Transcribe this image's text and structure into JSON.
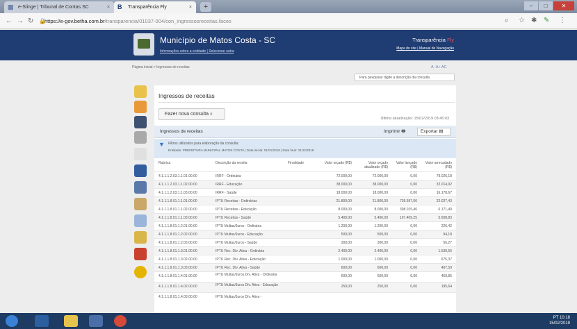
{
  "browser": {
    "tabs": [
      {
        "label": "e-Slinge | Tribunal de Contas SC"
      },
      {
        "label": "Transparência Fly"
      }
    ],
    "new_tab": "+",
    "url_host": "https://e-gov.betha.com.br",
    "url_path": "/transparencia/01037-004/con_ingressosreceitas.faces"
  },
  "header": {
    "municipality": "Município de Matos Costa - SC",
    "links": "Informações sobre a entidade | Selecionar outra",
    "brand": "Transparência",
    "brand_accent": "Fly",
    "brand_links": "Mapa do site | Manual de Navegação"
  },
  "breadcrumb": "Página inicial  >  Ingressos de receitas",
  "zoom": "A-  A+  AC",
  "search_placeholder": "Para pesquisar digite a descrição da consulta",
  "content": {
    "title": "Ingressos de receitas",
    "new_query": "Fazer nova consulta",
    "last_update": "Última atualização: 15/02/2019 03:45:03",
    "table_title": "Ingressos de receitas",
    "print": "Imprimir",
    "export": "Exportar",
    "filter_line1": "Filtros utilizados para elaboração da consulta:",
    "filter_line2": "Entidade: PREFEITURA MUNICIPAL MATOS COSTA | Data inicial: 01/01/2018 | Data final: 31/12/2018",
    "columns": [
      "Rubrica",
      "Descrição da receita",
      "Finalidade",
      "Valor orçado (R$)",
      "Valor orçado atualizado (R$)",
      "Valor lançado (R$)",
      "Valor arrecadado (R$)"
    ],
    "rows": [
      [
        "4.1.1.1.2.03.1.1.01.00.00",
        "IRRF - Ordinária",
        "",
        "72.000,00",
        "72.000,00",
        "0,00",
        "79.026,18"
      ],
      [
        "4.1.1.1.2.03.1.1.02.00.00",
        "IRRF - Educação",
        "",
        "38.000,00",
        "38.000,00",
        "0,00",
        "32.014,92"
      ],
      [
        "4.1.1.1.2.03.1.1.03.00.00",
        "IRRF - Saúde",
        "",
        "18.000,00",
        "18.000,00",
        "0,00",
        "16.178,67"
      ],
      [
        "4.1.1.1.8.01.1.1.01.00.00",
        "IPTU Receitas - Ordinárias",
        "",
        "21.800,00",
        "21.800,00",
        "739.697,00",
        "22.027,43"
      ],
      [
        "4.1.1.1.8.01.1.1.02.00.00",
        "IPTU Receitas - Educação",
        "",
        "8.000,00",
        "8.000,00",
        "308.015,46",
        "6.171,49"
      ],
      [
        "4.1.1.1.8.01.1.1.03.00.00",
        "IPTU Receitas - Saúde",
        "",
        "5.400,00",
        "5.400,00",
        "197.409,25",
        "5.608,83"
      ],
      [
        "4.1.1.1.8.01.1.2.01.00.00",
        "IPTU Multas/Juros - Ordinária",
        "",
        "1.200,00",
        "1.200,00",
        "0,00",
        "226,42"
      ],
      [
        "4.1.1.1.8.01.1.2.02.00.00",
        "IPTU Multas/Juros - Educação",
        "",
        "500,00",
        "500,00",
        "0,00",
        "94,18"
      ],
      [
        "4.1.1.1.8.01.1.2.03.00.00",
        "IPTU Multas/Juros - Saúde",
        "",
        "300,00",
        "300,00",
        "0,00",
        "56,27"
      ],
      [
        "4.1.1.1.8.01.1.3.01.00.00",
        "IPTU Rec. Dív. Ativa - Ordinária",
        "",
        "2.400,00",
        "2.400,00",
        "0,00",
        "1.630,55"
      ],
      [
        "4.1.1.1.8.01.1.3.02.00.00",
        "IPTU Rec. Dív. Ativa - Educação",
        "",
        "1.000,00",
        "1.000,00",
        "0,00",
        "675,37"
      ],
      [
        "4.1.1.1.8.01.1.3.03.00.00",
        "IPTU Rec. Dív. Ativa - Saúde",
        "",
        "600,00",
        "600,00",
        "0,00",
        "407,59"
      ],
      [
        "4.1.1.1.8.01.1.4.01.00.00",
        "IPTU Multas/Juros Dív. Ativa - Ordinária",
        "",
        "600,00",
        "600,00",
        "0,00",
        "469,85"
      ],
      [
        "4.1.1.1.8.01.1.4.02.00.00",
        "IPTU Multas/Juros Dív. Ativa - Educação",
        "",
        "250,00",
        "250,00",
        "0,00",
        "195,64"
      ],
      [
        "4.1.1.1.8.01.1.4.03.00.00",
        "IPTU Multas/Juros Dív. Ativa -",
        "",
        "",
        "",
        "",
        ""
      ]
    ]
  },
  "tray": {
    "lang": "PT",
    "time": "10:18",
    "date": "15/02/2019"
  }
}
